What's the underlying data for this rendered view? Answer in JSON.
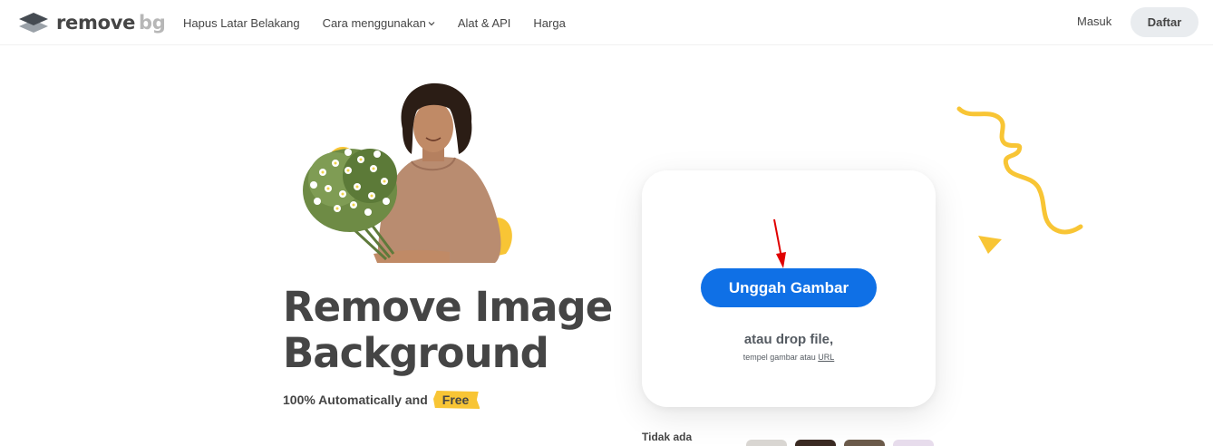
{
  "header": {
    "logo_text": "remove",
    "logo_text_bg": "bg",
    "nav": [
      {
        "label": "Hapus Latar Belakang"
      },
      {
        "label": "Cara menggunakan",
        "has_dropdown": true
      },
      {
        "label": "Alat & API"
      },
      {
        "label": "Harga"
      }
    ],
    "login_label": "Masuk",
    "signup_label": "Daftar"
  },
  "hero": {
    "title_line1": "Remove Image",
    "title_line2": "Background",
    "subtitle": "100% Automatically and",
    "free_label": "Free"
  },
  "upload": {
    "button_label": "Unggah Gambar",
    "drop_text": "atau drop file,",
    "paste_text": "tempel gambar atau",
    "url_label": "URL"
  },
  "bottom": {
    "no_image_label": "Tidak ada"
  },
  "colors": {
    "primary_blue": "#0f70e6",
    "accent_yellow": "#f8c535",
    "text_dark": "#454545",
    "arrow_red": "#e00000"
  },
  "icons": {
    "logo": "removebg-logo-icon",
    "dropdown": "chevron-down-icon",
    "arrow": "red-arrow-icon"
  }
}
